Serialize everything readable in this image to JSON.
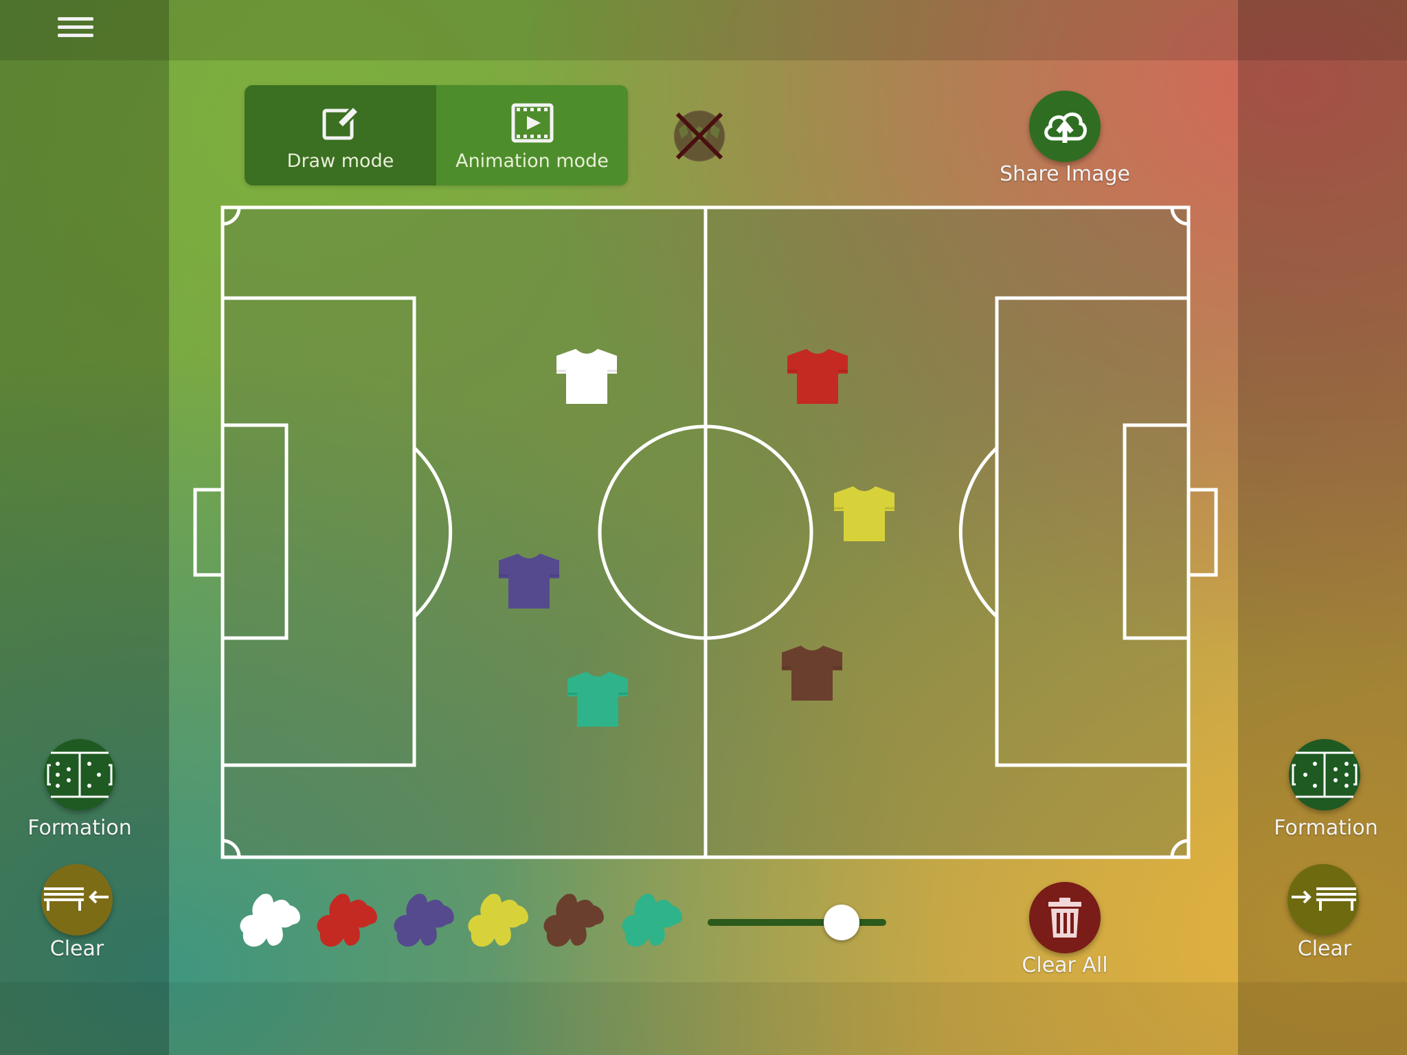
{
  "header": {
    "menu_icon": "hamburger-menu-icon"
  },
  "modes": {
    "draw": {
      "label": "Draw mode",
      "icon": "edit-icon",
      "active": true
    },
    "animation": {
      "label": "Animation mode",
      "icon": "film-icon",
      "active": false
    }
  },
  "ball_toggle": {
    "icon": "ball-disabled-icon",
    "state": "off"
  },
  "share": {
    "label": "Share Image",
    "icon": "cloud-upload-icon"
  },
  "left_panel": {
    "formation": {
      "label": "Formation",
      "icon": "formation-icon"
    },
    "clear": {
      "label": "Clear",
      "icon": "bench-arrow-in-icon"
    }
  },
  "right_panel": {
    "formation": {
      "label": "Formation",
      "icon": "formation-icon"
    },
    "clear": {
      "label": "Clear",
      "icon": "bench-arrow-out-icon"
    }
  },
  "pitch": {
    "icon": "football-pitch"
  },
  "players": [
    {
      "name": "white-shirt",
      "color": "#ffffff"
    },
    {
      "name": "red-shirt",
      "color": "#c42a22"
    },
    {
      "name": "purple-shirt",
      "color": "#564a8f"
    },
    {
      "name": "yellow-shirt",
      "color": "#d8d23a"
    },
    {
      "name": "teal-shirt",
      "color": "#2fb38a"
    },
    {
      "name": "brown-shirt",
      "color": "#6b3f2e"
    }
  ],
  "palette": [
    {
      "name": "white",
      "color": "#ffffff"
    },
    {
      "name": "red",
      "color": "#c42a22"
    },
    {
      "name": "purple",
      "color": "#564a8f"
    },
    {
      "name": "yellow",
      "color": "#d8d23a"
    },
    {
      "name": "brown",
      "color": "#6b3f2e"
    },
    {
      "name": "teal",
      "color": "#2fb38a"
    }
  ],
  "size_slider": {
    "value": 0.75
  },
  "clear_all": {
    "label": "Clear All",
    "icon": "trash-icon"
  },
  "colors": {
    "accent_green": "#2f6e22",
    "danger_red": "#7a1c18",
    "mustard": "#7d6c16"
  }
}
